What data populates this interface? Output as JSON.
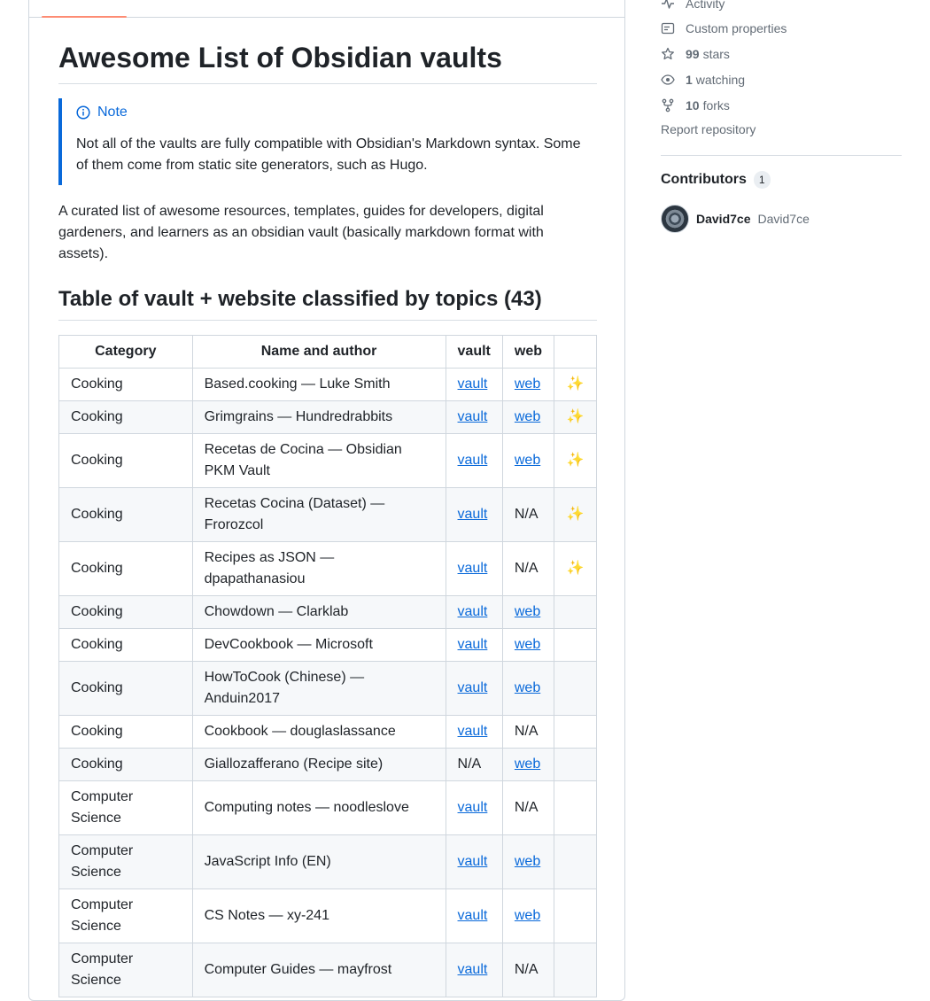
{
  "readme": {
    "title": "Awesome List of Obsidian vaults",
    "note": {
      "label": "Note",
      "text": "Not all of the vaults are fully compatible with Obsidian's Markdown syntax. Some of them come from static site generators, such as Hugo."
    },
    "intro": "A curated list of awesome resources, templates, guides for developers, digital gardeners, and learners as an obsidian vault (basically markdown format with assets).",
    "table_heading": "Table of vault + website classified by topics (43)",
    "table": {
      "headers": [
        "Category",
        "Name and author",
        "vault",
        "web",
        ""
      ],
      "rows": [
        {
          "category": "Cooking",
          "name": "Based.cooking — Luke Smith",
          "vault": "vault",
          "web": "web",
          "star": "✨"
        },
        {
          "category": "Cooking",
          "name": "Grimgrains — Hundredrabbits",
          "vault": "vault",
          "web": "web",
          "star": "✨"
        },
        {
          "category": "Cooking",
          "name": "Recetas de Cocina — Obsidian PKM Vault",
          "vault": "vault",
          "web": "web",
          "star": "✨"
        },
        {
          "category": "Cooking",
          "name": "Recetas Cocina (Dataset) — Frorozcol",
          "vault": "vault",
          "web": "N/A",
          "star": "✨"
        },
        {
          "category": "Cooking",
          "name": "Recipes as JSON — dpapathanasiou",
          "vault": "vault",
          "web": "N/A",
          "star": "✨"
        },
        {
          "category": "Cooking",
          "name": "Chowdown — Clarklab",
          "vault": "vault",
          "web": "web",
          "star": ""
        },
        {
          "category": "Cooking",
          "name": "DevCookbook — Microsoft",
          "vault": "vault",
          "web": "web",
          "star": ""
        },
        {
          "category": "Cooking",
          "name": "HowToCook (Chinese) — Anduin2017",
          "vault": "vault",
          "web": "web",
          "star": ""
        },
        {
          "category": "Cooking",
          "name": "Cookbook — douglaslassance",
          "vault": "vault",
          "web": "N/A",
          "star": ""
        },
        {
          "category": "Cooking",
          "name": "Giallozafferano (Recipe site)",
          "vault": "N/A",
          "web": "web",
          "star": ""
        },
        {
          "category": "Computer Science",
          "name": "Computing notes — noodleslove",
          "vault": "vault",
          "web": "N/A",
          "star": ""
        },
        {
          "category": "Computer Science",
          "name": "JavaScript Info (EN)",
          "vault": "vault",
          "web": "web",
          "star": ""
        },
        {
          "category": "Computer Science",
          "name": "CS Notes — xy-241",
          "vault": "vault",
          "web": "web",
          "star": ""
        },
        {
          "category": "Computer Science",
          "name": "Computer Guides — mayfrost",
          "vault": "vault",
          "web": "N/A",
          "star": ""
        }
      ]
    }
  },
  "sidebar": {
    "activity_label": "Activity",
    "custom_properties_label": "Custom properties",
    "stars_count": "99",
    "stars_label": "stars",
    "watching_count": "1",
    "watching_label": "watching",
    "forks_count": "10",
    "forks_label": "forks",
    "report_label": "Report repository",
    "contributors_title": "Contributors",
    "contributors_count": "1",
    "contributor_name": "David7ce",
    "contributor_login": "David7ce"
  }
}
